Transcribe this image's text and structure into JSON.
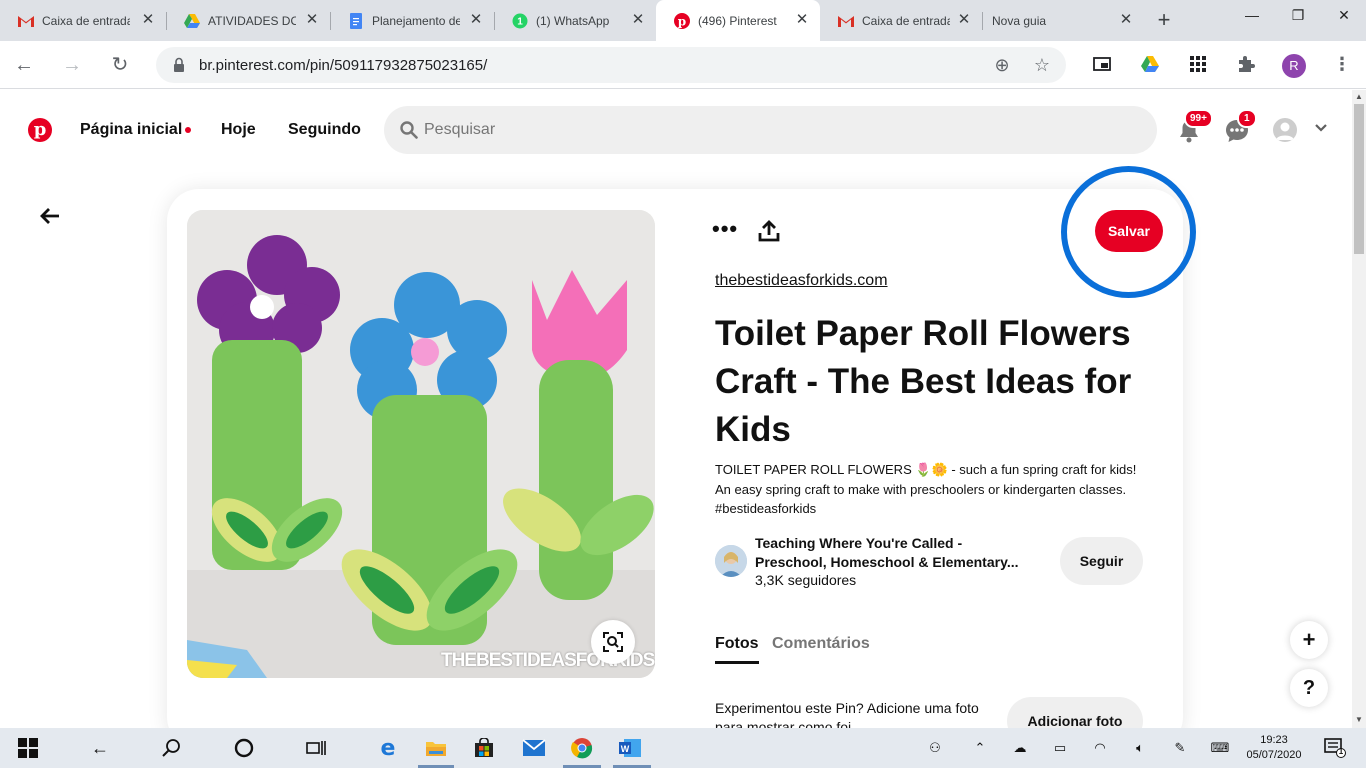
{
  "browser": {
    "tabs": [
      {
        "title": "Caixa de entrada",
        "icon": "gmail-icon"
      },
      {
        "title": "ATIVIDADES DO",
        "icon": "drive-icon"
      },
      {
        "title": "Planejamento de",
        "icon": "docs-icon"
      },
      {
        "title": "(1) WhatsApp",
        "icon": "whatsapp-icon"
      },
      {
        "title": "(496) Pinterest",
        "icon": "pinterest-icon"
      },
      {
        "title": "Caixa de entrada",
        "icon": "gmail-icon"
      },
      {
        "title": "Nova guia",
        "icon": ""
      }
    ],
    "url": "br.pinterest.com/pin/509117932875023165/",
    "profile_initial": "R"
  },
  "pinterest": {
    "nav": {
      "home": "Página inicial",
      "today": "Hoje",
      "following": "Seguindo"
    },
    "search_placeholder": "Pesquisar",
    "notifications_badge": "99+",
    "messages_badge": "1",
    "pin": {
      "save_label": "Salvar",
      "source": "thebestideasforkids.com",
      "title": "Toilet Paper Roll Flowers Craft - The Best Ideas for Kids",
      "description": "TOILET PAPER ROLL FLOWERS 🌷🌼 - such a fun spring craft for kids! An easy spring craft to make with preschoolers or kindergarten classes. #bestideasforkids",
      "image_watermark": "THEBESTIDEASFORKIDS.COM",
      "creator_name": "Teaching Where You're Called - Preschool, Homeschool & Elementary...",
      "creator_followers": "3,3K seguidores",
      "follow_label": "Seguir",
      "tab_photos": "Fotos",
      "tab_comments": "Comentários",
      "tried_text": "Experimentou este Pin? Adicione uma foto para mostrar como foi",
      "add_photo_label": "Adicionar foto"
    },
    "floating": {
      "plus": "+",
      "help": "?"
    }
  },
  "taskbar": {
    "time": "19:23",
    "date": "05/07/2020",
    "notification_count": "1"
  },
  "colors": {
    "pinterest_red": "#e60023",
    "highlight_blue": "#0a6fd9"
  }
}
